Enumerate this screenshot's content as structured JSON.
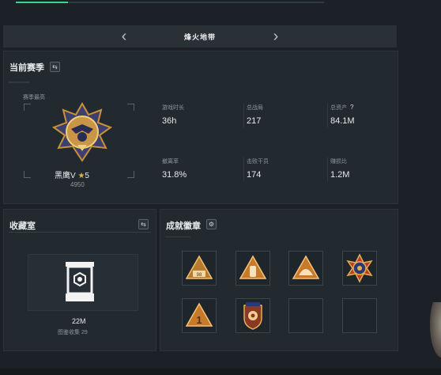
{
  "map": {
    "name": "烽火地带"
  },
  "season": {
    "title": "当前赛季",
    "best_label": "赛季最高",
    "rank_name": "黑鹰V",
    "rank_stars": "5",
    "rank_score": "4950",
    "stats": [
      {
        "label": "游戏时长",
        "value": "36h"
      },
      {
        "label": "总战局",
        "value": "217"
      },
      {
        "label": "总资产",
        "value": "84.1M",
        "help": "?"
      },
      {
        "label": "撤离率",
        "value": "31.8%"
      },
      {
        "label": "击败干员",
        "value": "174"
      },
      {
        "label": "赚损比",
        "value": "1.2M"
      }
    ]
  },
  "collection": {
    "title": "收藏室",
    "value": "22M",
    "count_label": "图鉴收集",
    "count": "29"
  },
  "achievements": {
    "title": "成就徽章",
    "badges": [
      {
        "icon": "triangle-badge-98"
      },
      {
        "icon": "triangle-badge-bottle"
      },
      {
        "icon": "triangle-badge-dome"
      },
      {
        "icon": "cross-emblem-badge"
      },
      {
        "icon": "triangle-badge-1"
      },
      {
        "icon": "shield-emblem-badge"
      },
      {
        "icon": "empty-slot"
      },
      {
        "icon": "empty-slot"
      }
    ]
  },
  "colors": {
    "accent": "#3fd08a",
    "gold": "#c9913a",
    "panel": "#222a2f"
  }
}
